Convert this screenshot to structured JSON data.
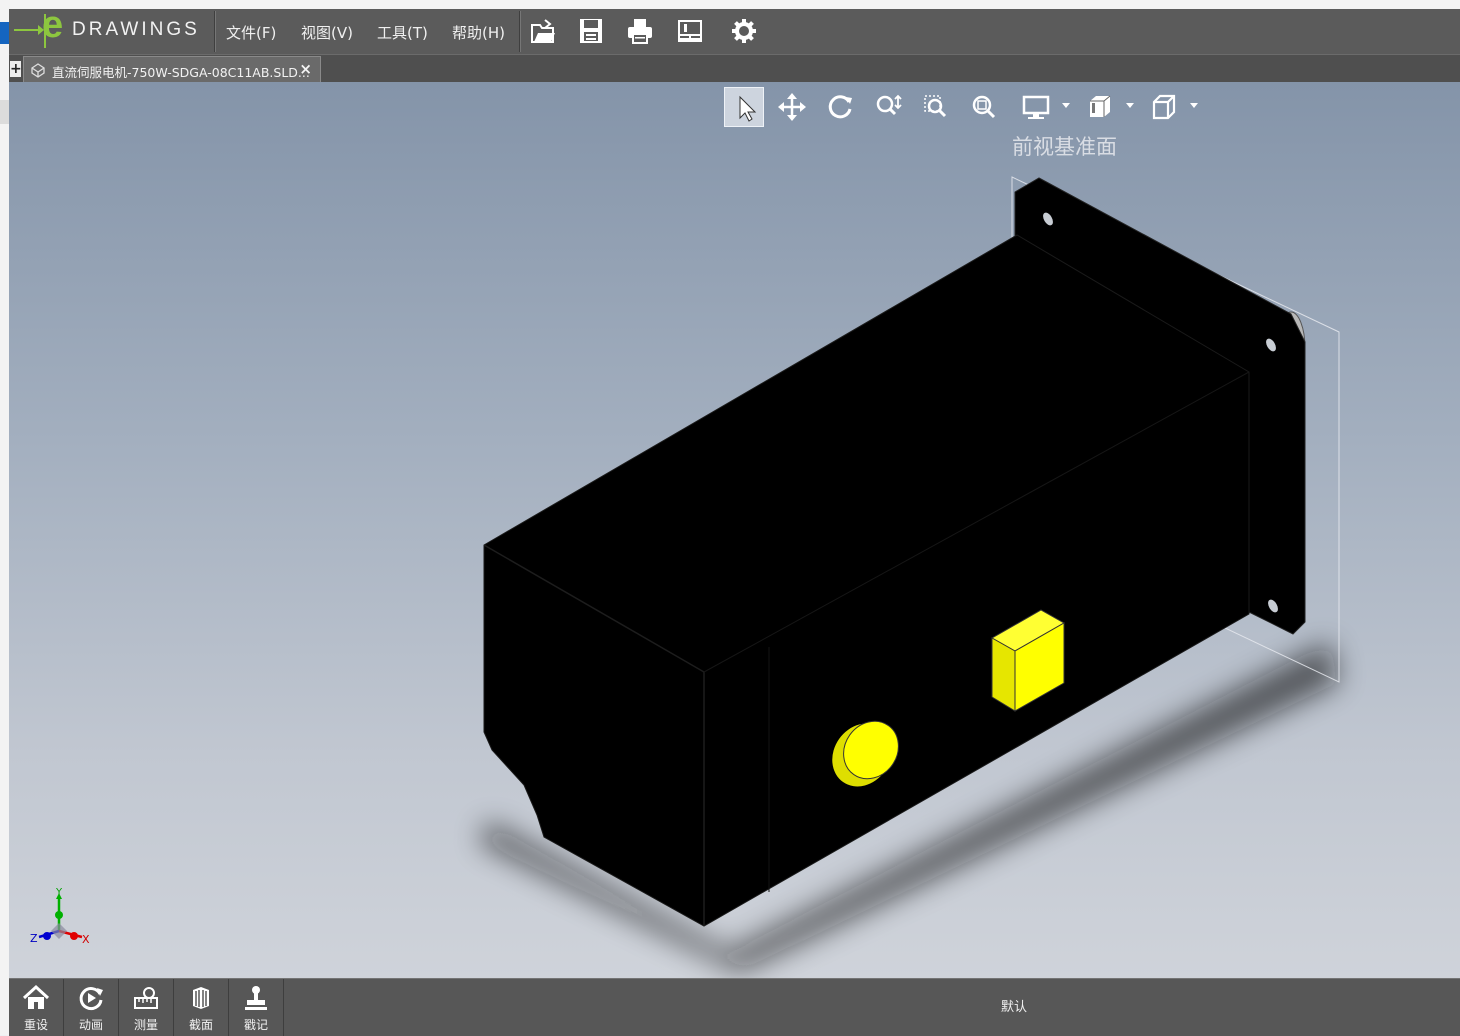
{
  "app": {
    "logo_text": "DRAWINGS",
    "menu": [
      "文件(F)",
      "视图(V)",
      "工具(T)",
      "帮助(H)"
    ],
    "toolbar_icons": [
      "open-icon",
      "save-icon",
      "print-icon",
      "sheet-properties-icon",
      "settings-gear-icon"
    ]
  },
  "tab": {
    "title": "直流伺服电机-750W-SDGA-08C11AB.SLD...",
    "close": "×",
    "new_tab": "+"
  },
  "viewport": {
    "plane_label": "前视基准面",
    "hud_icons": [
      "select-icon",
      "pan-icon",
      "rotate-icon",
      "zoom-icon",
      "zoom-to-area-icon",
      "zoom-to-fit-icon",
      "display-style-icon",
      "view-orientation-icon",
      "box-view-icon"
    ],
    "triad": {
      "y": "Y",
      "z": "Z",
      "x": "X"
    },
    "colors": {
      "model": "#000000",
      "connector": "#ffff00",
      "bg_top": "#8494a9",
      "bg_bottom": "#cfd3da"
    }
  },
  "bottom": {
    "buttons": [
      {
        "label": "重设",
        "icon": "home-icon"
      },
      {
        "label": "动画",
        "icon": "animate-icon"
      },
      {
        "label": "测量",
        "icon": "measure-icon"
      },
      {
        "label": "截面",
        "icon": "section-icon"
      },
      {
        "label": "戳记",
        "icon": "stamp-icon"
      }
    ],
    "configuration": "默认"
  }
}
